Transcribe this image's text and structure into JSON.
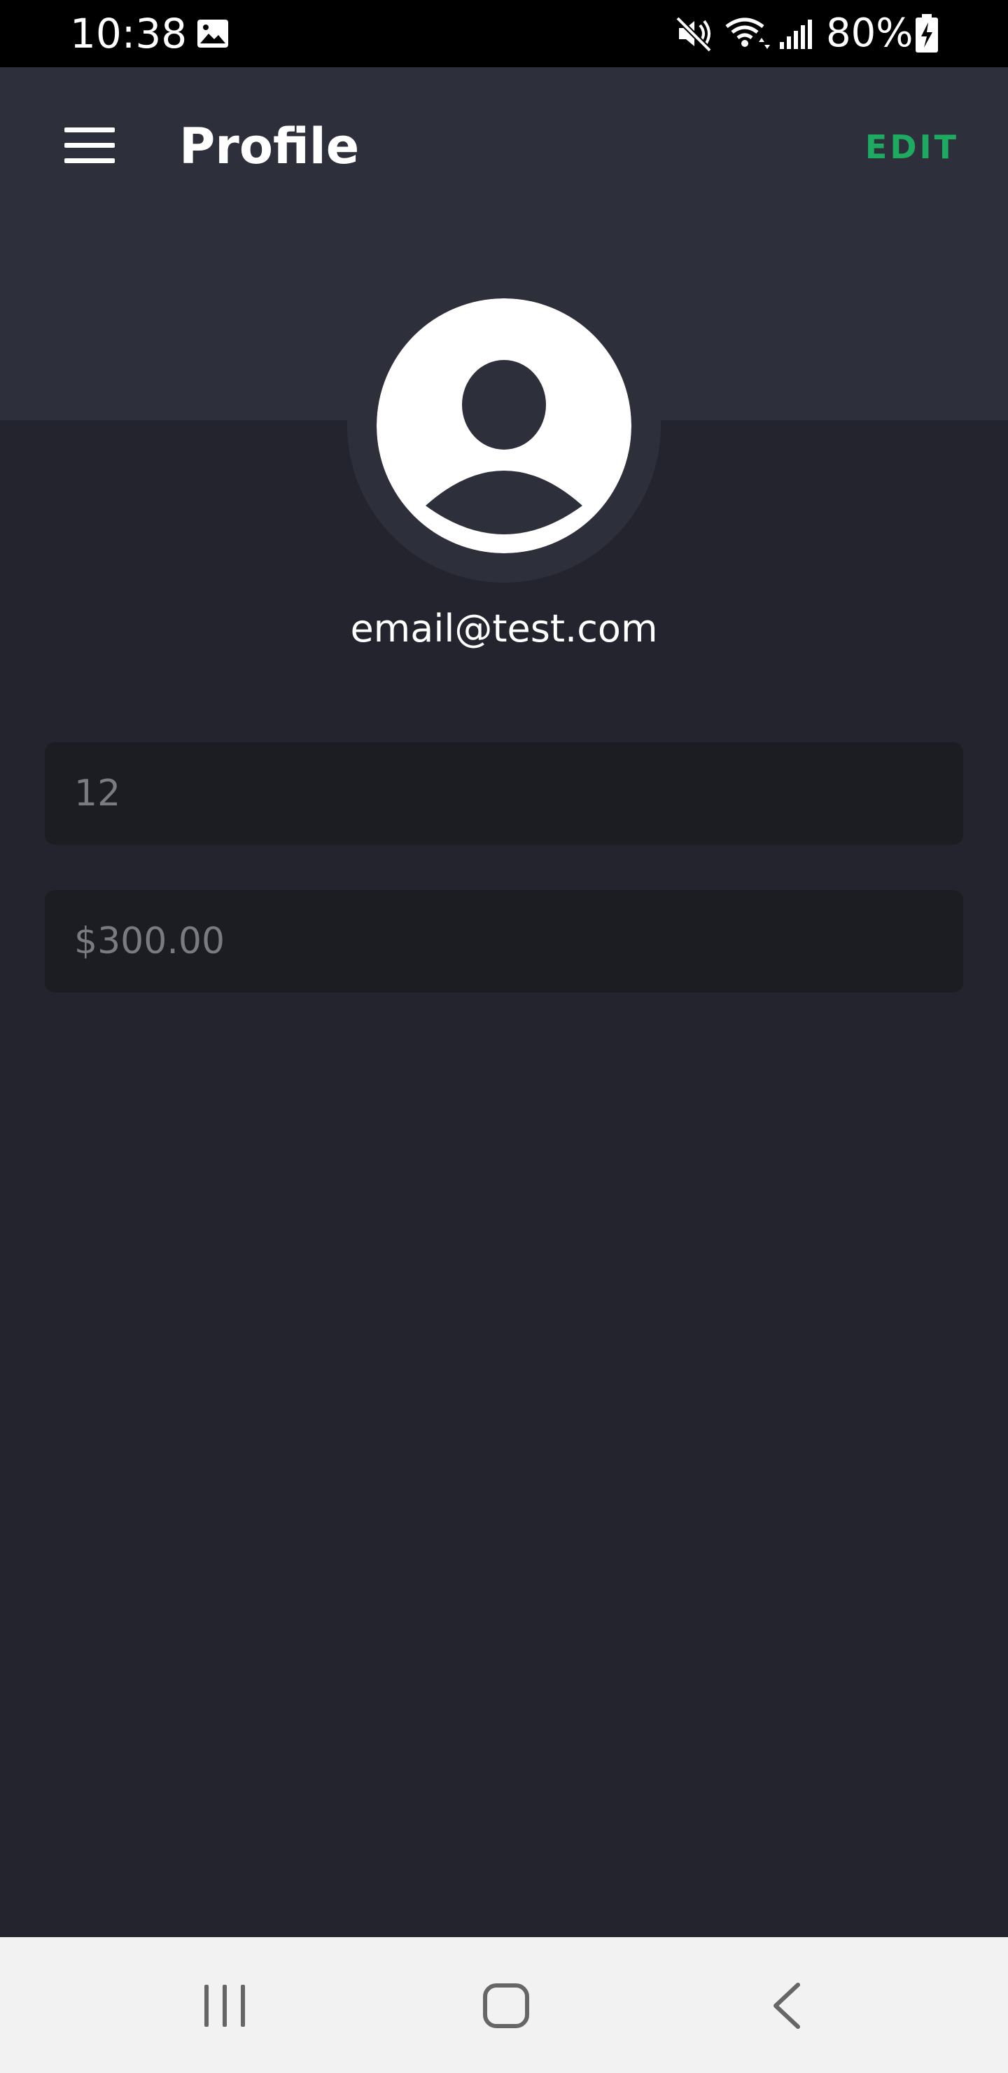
{
  "status_bar": {
    "time": "10:38",
    "battery": "80%",
    "icons": [
      "gallery-icon",
      "mute-icon",
      "wifi-icon",
      "signal-icon",
      "battery-icon"
    ]
  },
  "header": {
    "title": "Profile",
    "edit_label": "EDIT",
    "menu_icon": "menu-icon"
  },
  "profile": {
    "email": "email@test.com",
    "avatar_icon": "user-avatar-icon"
  },
  "fields": [
    {
      "value": "12"
    },
    {
      "value": "$300.00"
    }
  ],
  "nav_bar": {
    "icons": [
      "recents-icon",
      "home-icon",
      "back-icon"
    ]
  },
  "colors": {
    "background": "#23242d",
    "header": "#2d2f3a",
    "field": "#1c1d22",
    "accent": "#1eaa61",
    "field_text": "#7a7b80"
  }
}
